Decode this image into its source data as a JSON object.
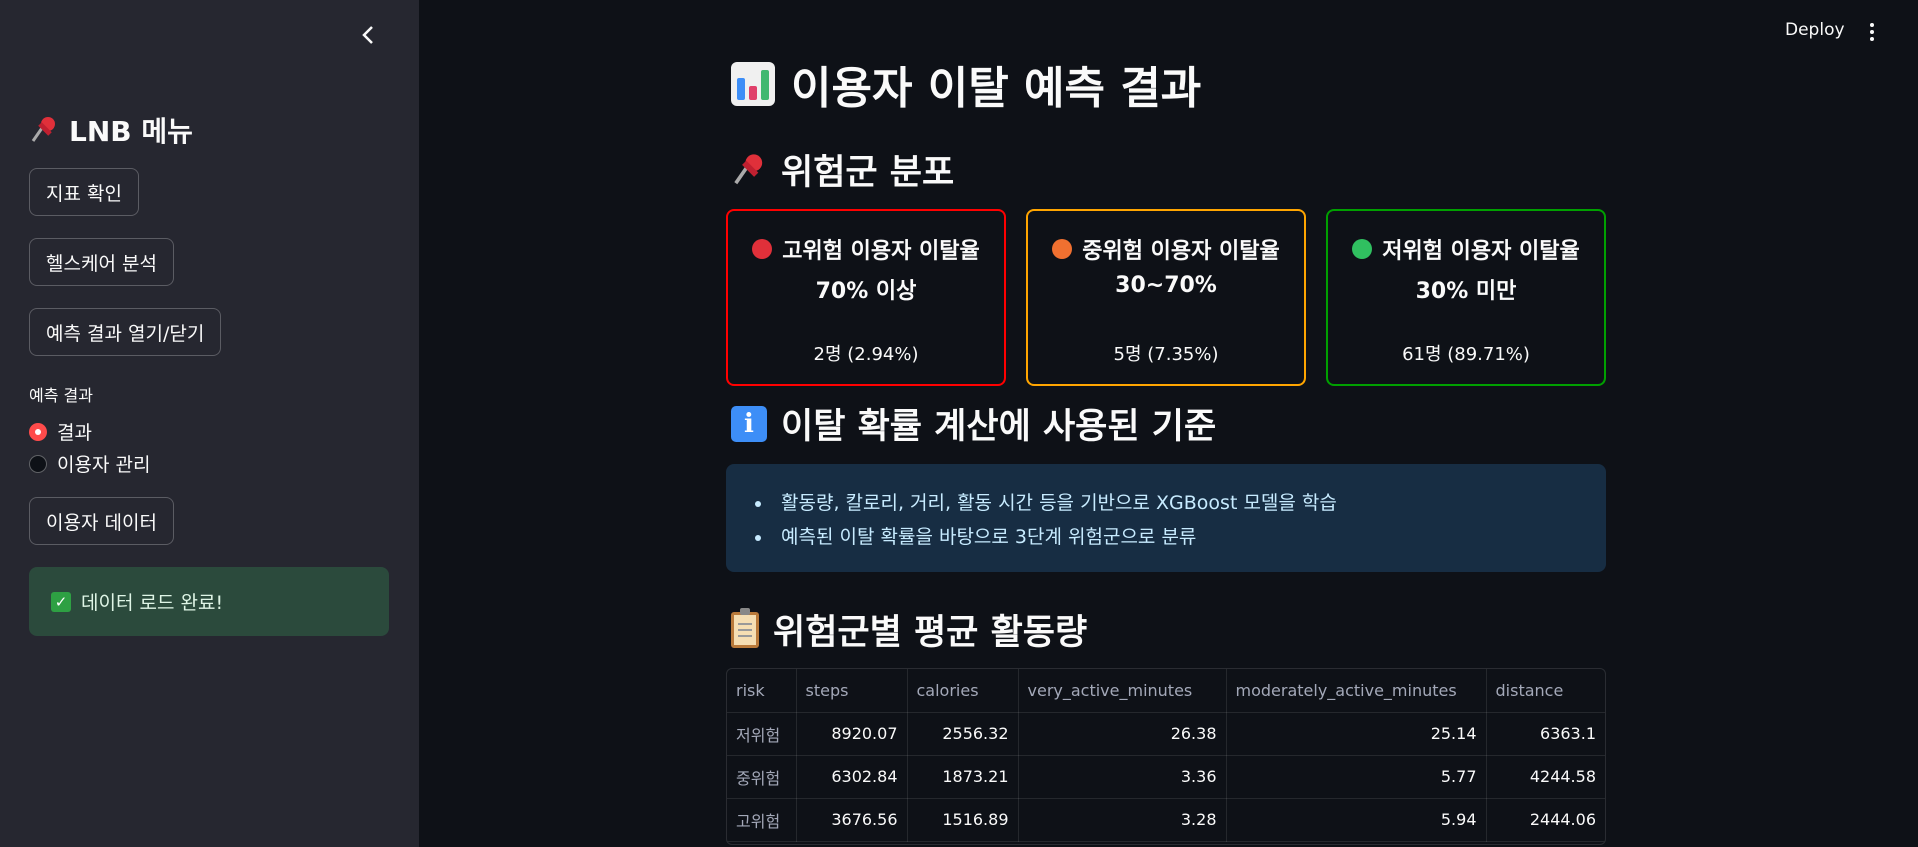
{
  "sidebar": {
    "heading": "LNB 메뉴",
    "buttons": [
      "지표 확인",
      "헬스케어 분석",
      "예측 결과 열기/닫기",
      "이용자 데이터"
    ],
    "radio_label": "예측 결과",
    "radio_options": [
      "결과",
      "이용자 관리"
    ],
    "radio_selected": "결과",
    "success_text": "데이터 로드 완료!"
  },
  "header": {
    "deploy": "Deploy"
  },
  "main": {
    "title": "이용자 이탈 예측 결과",
    "section1": "위험군 분포",
    "cards": [
      {
        "title": "고위험 이용자 이탈율",
        "sub": "70% 이상",
        "count": "2명 (2.94%)",
        "color": "#ff0000",
        "dot": "#e0303a"
      },
      {
        "title": "중위험 이용자 이탈율",
        "sub": "30~70%",
        "count": "5명 (7.35%)",
        "color": "#ffa500",
        "dot": "#f07030"
      },
      {
        "title": "저위험 이용자 이탈율",
        "sub": "30% 미만",
        "count": "61명 (89.71%)",
        "color": "#00a000",
        "dot": "#30c060"
      }
    ],
    "section2": "이탈 확률 계산에 사용된 기준",
    "info_items": [
      "활동량, 칼로리, 거리, 활동 시간 등을 기반으로 XGBoost 모델을 학습",
      "예측된 이탈 확률을 바탕으로 3단계 위험군으로 분류"
    ],
    "section3": "위험군별 평균 활동량",
    "table": {
      "columns": [
        "risk",
        "steps",
        "calories",
        "very_active_minutes",
        "moderately_active_minutes",
        "distance"
      ],
      "rows": [
        [
          "저위험",
          "8920.07",
          "2556.32",
          "26.38",
          "25.14",
          "6363.1"
        ],
        [
          "중위험",
          "6302.84",
          "1873.21",
          "3.36",
          "5.77",
          "4244.58"
        ],
        [
          "고위험",
          "3676.56",
          "1516.89",
          "3.28",
          "5.94",
          "2444.06"
        ]
      ]
    }
  },
  "icons": {
    "collapse": "chevron-left-icon",
    "pin": "pushpin-icon",
    "chart": "bar-chart-icon",
    "info": "info-icon",
    "clipboard": "clipboard-icon",
    "check": "check-icon"
  }
}
